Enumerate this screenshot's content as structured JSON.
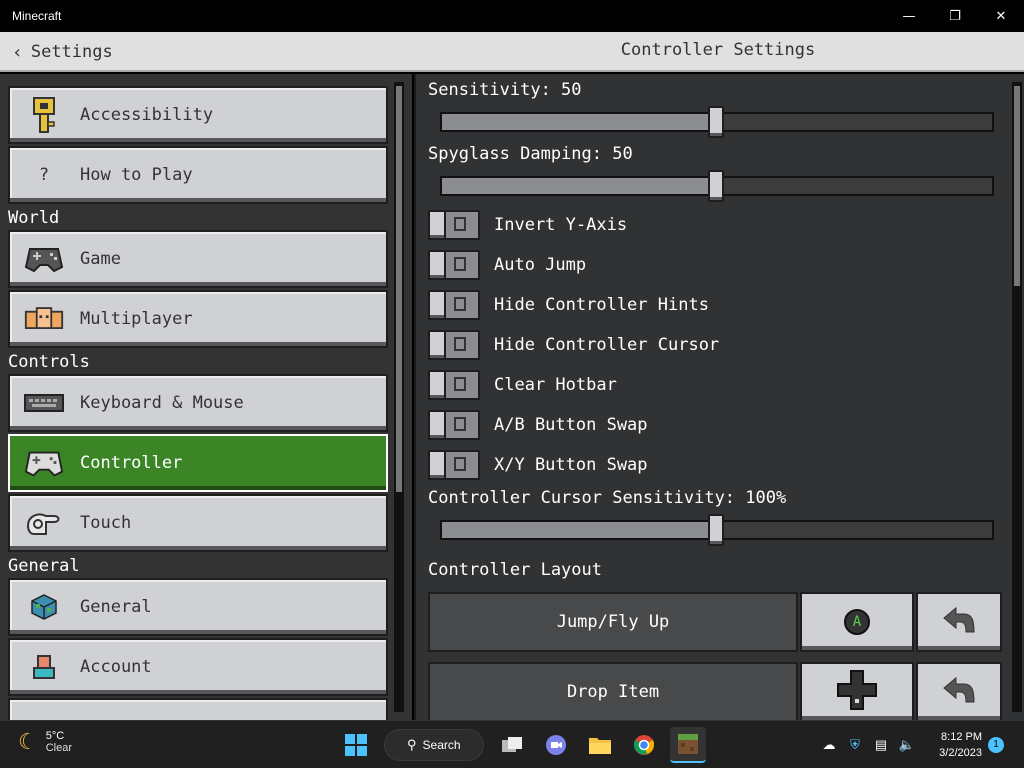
{
  "window": {
    "title": "Minecraft"
  },
  "header": {
    "back_label": "Settings",
    "title": "Controller Settings"
  },
  "sidebar": {
    "items_top": [
      {
        "label": "Accessibility",
        "icon": "key-icon"
      },
      {
        "label": "How to Play",
        "icon": "question-icon",
        "glyph": "?"
      }
    ],
    "sections": [
      {
        "label": "World",
        "items": [
          {
            "label": "Game",
            "icon": "gamepad-icon"
          },
          {
            "label": "Multiplayer",
            "icon": "multiplayer-icon"
          }
        ]
      },
      {
        "label": "Controls",
        "items": [
          {
            "label": "Keyboard & Mouse",
            "icon": "keyboard-icon"
          },
          {
            "label": "Controller",
            "icon": "controller-icon",
            "active": true
          },
          {
            "label": "Touch",
            "icon": "touch-icon"
          }
        ]
      },
      {
        "label": "General",
        "items": [
          {
            "label": "General",
            "icon": "globe-cube-icon"
          },
          {
            "label": "Account",
            "icon": "account-icon"
          }
        ]
      }
    ]
  },
  "settings": {
    "sensitivity": {
      "label": "Sensitivity: 50",
      "value": 50
    },
    "spyglass": {
      "label": "Spyglass Damping: 50",
      "value": 50
    },
    "toggles": [
      {
        "label": "Invert Y-Axis",
        "on": false
      },
      {
        "label": "Auto Jump",
        "on": false
      },
      {
        "label": "Hide Controller Hints",
        "on": false
      },
      {
        "label": "Hide Controller Cursor",
        "on": false
      },
      {
        "label": "Clear Hotbar",
        "on": false
      },
      {
        "label": "A/B Button Swap",
        "on": false
      },
      {
        "label": "X/Y Button Swap",
        "on": false
      }
    ],
    "cursor_sensitivity": {
      "label": "Controller Cursor Sensitivity: 100%",
      "value": 50
    },
    "layout_heading": "Controller Layout",
    "layout": [
      {
        "action": "Jump/Fly Up",
        "key_icon": "a-button-icon",
        "key_glyph": "A"
      },
      {
        "action": "Drop Item",
        "key_icon": "dpad-icon"
      }
    ]
  },
  "taskbar": {
    "weather_temp": "5°C",
    "weather_desc": "Clear",
    "search_label": "Search",
    "time": "8:12 PM",
    "date": "3/2/2023",
    "notifications": "1"
  },
  "colors": {
    "accent_green": "#3c8527",
    "button_gray": "#d0d1d4",
    "panel_dark": "#313233"
  }
}
